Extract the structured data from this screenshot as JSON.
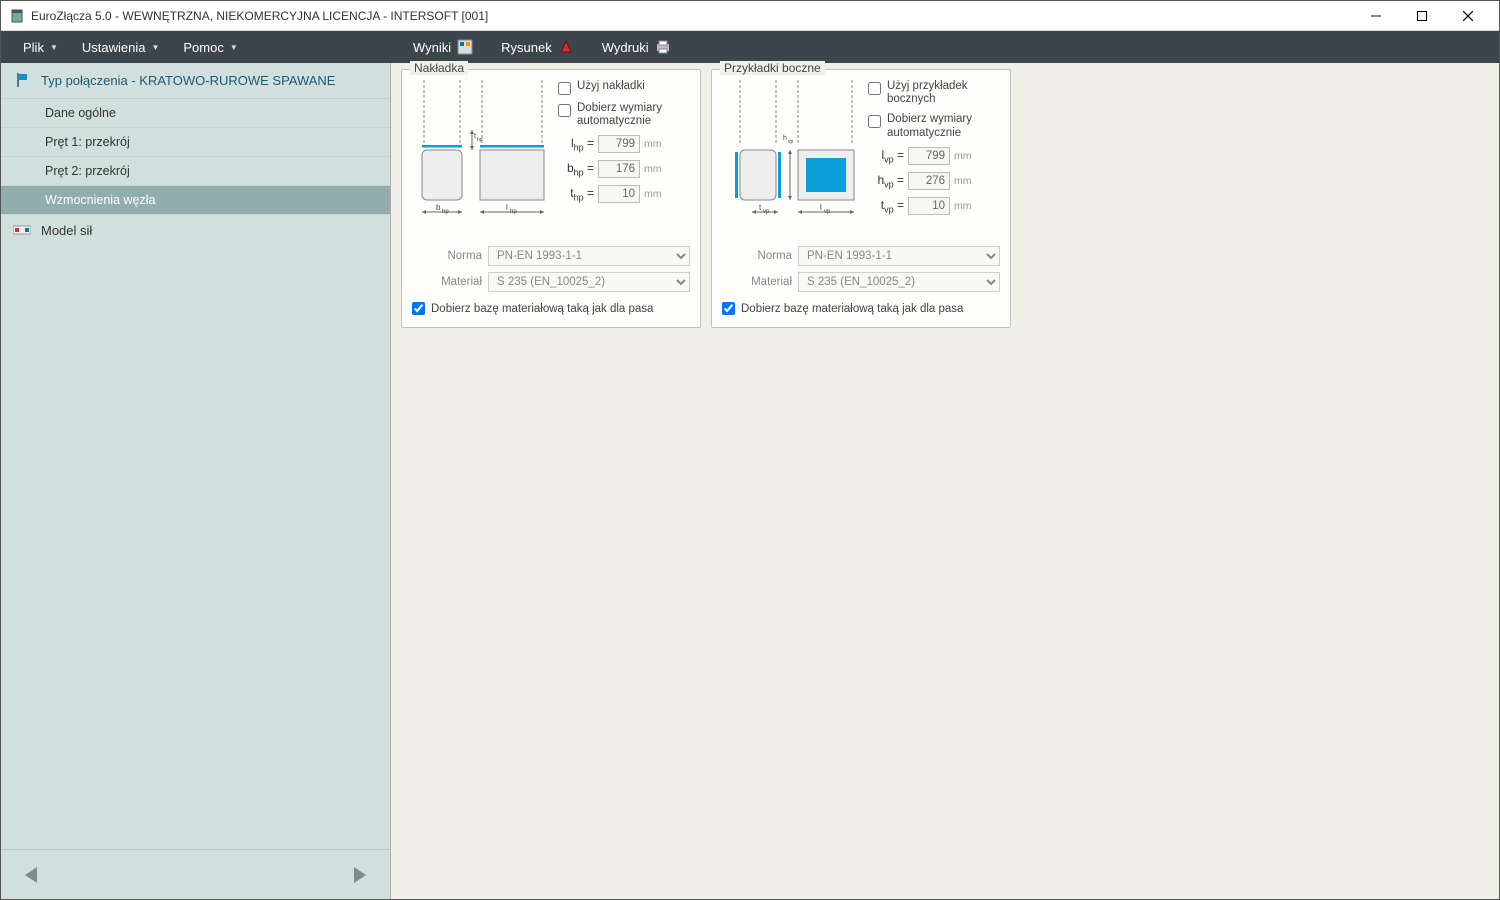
{
  "window": {
    "title": "EuroZłącza 5.0 - WEWNĘTRZNA, NIEKOMERCYJNA LICENCJA - INTERSOFT [001]"
  },
  "menu": {
    "left": [
      {
        "label": "Plik",
        "dropdown": true
      },
      {
        "label": "Ustawienia",
        "dropdown": true
      },
      {
        "label": "Pomoc",
        "dropdown": true
      }
    ],
    "right": [
      {
        "label": "Wyniki",
        "icon": "results"
      },
      {
        "label": "Rysunek",
        "icon": "drawing"
      },
      {
        "label": "Wydruki",
        "icon": "print"
      }
    ]
  },
  "sidebar": {
    "header": "Typ połączenia - KRATOWO-RUROWE SPAWANE",
    "items": [
      {
        "label": "Dane ogólne"
      },
      {
        "label": "Pręt 1: przekrój"
      },
      {
        "label": "Pręt 2: przekrój"
      },
      {
        "label": "Wzmocnienia węzła",
        "selected": true
      }
    ],
    "model": "Model sił"
  },
  "panels": {
    "nakladka": {
      "title": "Nakładka",
      "chk1": "Użyj nakładki",
      "chk2": "Dobierz wymiary automatycznie",
      "params": [
        {
          "sym": "l",
          "sub": "hp",
          "val": "799",
          "unit": "mm"
        },
        {
          "sym": "b",
          "sub": "hp",
          "val": "176",
          "unit": "mm"
        },
        {
          "sym": "t",
          "sub": "hp",
          "val": "10",
          "unit": "mm"
        }
      ],
      "norma_label": "Norma",
      "norma": "PN-EN 1993-1-1",
      "material_label": "Materiał",
      "material": "S 235 (EN_10025_2)",
      "bottom": "Dobierz bazę materiałową taką jak dla pasa"
    },
    "przykladki": {
      "title": "Przykładki boczne",
      "chk1": "Użyj przykładek bocznych",
      "chk2": "Dobierz wymiary automatycznie",
      "params": [
        {
          "sym": "l",
          "sub": "vp",
          "val": "799",
          "unit": "mm"
        },
        {
          "sym": "h",
          "sub": "vp",
          "val": "276",
          "unit": "mm"
        },
        {
          "sym": "t",
          "sub": "vp",
          "val": "10",
          "unit": "mm"
        }
      ],
      "norma_label": "Norma",
      "norma": "PN-EN 1993-1-1",
      "material_label": "Materiał",
      "material": "S 235 (EN_10025_2)",
      "bottom": "Dobierz bazę materiałową taką jak dla pasa"
    }
  }
}
